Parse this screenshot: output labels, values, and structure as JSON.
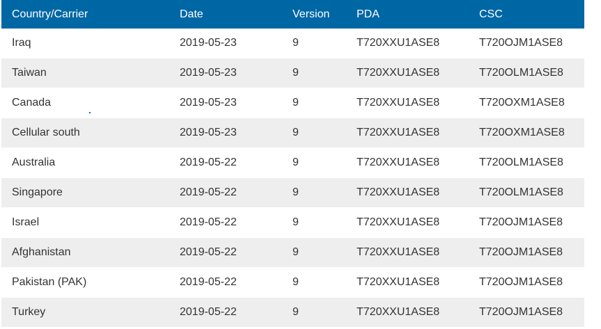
{
  "table": {
    "columns": [
      "Country/Carrier",
      "Date",
      "Version",
      "PDA",
      "CSC"
    ],
    "rows": [
      [
        "Iraq",
        "2019-05-23",
        "9",
        "T720XXU1ASE8",
        "T720OJM1ASE8"
      ],
      [
        "Taiwan",
        "2019-05-23",
        "9",
        "T720XXU1ASE8",
        "T720OLM1ASE8"
      ],
      [
        "Canada",
        "2019-05-23",
        "9",
        "T720XXU1ASE8",
        "T720OXM1ASE8"
      ],
      [
        "Cellular south",
        "2019-05-23",
        "9",
        "T720XXU1ASE8",
        "T720OXM1ASE8"
      ],
      [
        "Australia",
        "2019-05-22",
        "9",
        "T720XXU1ASE8",
        "T720OLM1ASE8"
      ],
      [
        "Singapore",
        "2019-05-22",
        "9",
        "T720XXU1ASE8",
        "T720OLM1ASE8"
      ],
      [
        "Israel",
        "2019-05-22",
        "9",
        "T720XXU1ASE8",
        "T720OJM1ASE8"
      ],
      [
        "Afghanistan",
        "2019-05-22",
        "9",
        "T720XXU1ASE8",
        "T720OJM1ASE8"
      ],
      [
        "Pakistan (PAK)",
        "2019-05-22",
        "9",
        "T720XXU1ASE8",
        "T720OJM1ASE8"
      ],
      [
        "Turkey",
        "2019-05-22",
        "9",
        "T720XXU1ASE8",
        "T720OJM1ASE8"
      ]
    ]
  },
  "colors": {
    "header_bg": "#0067a5",
    "header_text": "#ffffff",
    "row_alt_bg": "#eeeeee",
    "cell_text": "#333333"
  }
}
